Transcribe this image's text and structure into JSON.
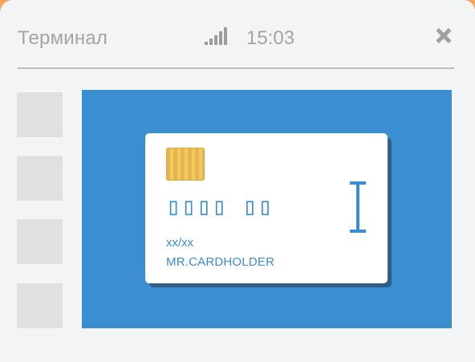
{
  "header": {
    "title": "Терминал",
    "time": "15:03",
    "signal_icon": "signal-strength-icon",
    "close_icon": "close-icon"
  },
  "sidebar": {
    "buttons": [
      "",
      "",
      "",
      ""
    ]
  },
  "card": {
    "number": "▯▯▯▯ ▯▯",
    "expiry": "xx/xx",
    "holder": "MR.CARDHOLDER",
    "chip_icon": "card-chip-icon",
    "cursor_icon": "text-cursor-icon"
  },
  "colors": {
    "accent": "#3b8ecf",
    "frame": "#f3a55a",
    "background": "#f3f4f5",
    "chip": "#e8b54a"
  }
}
